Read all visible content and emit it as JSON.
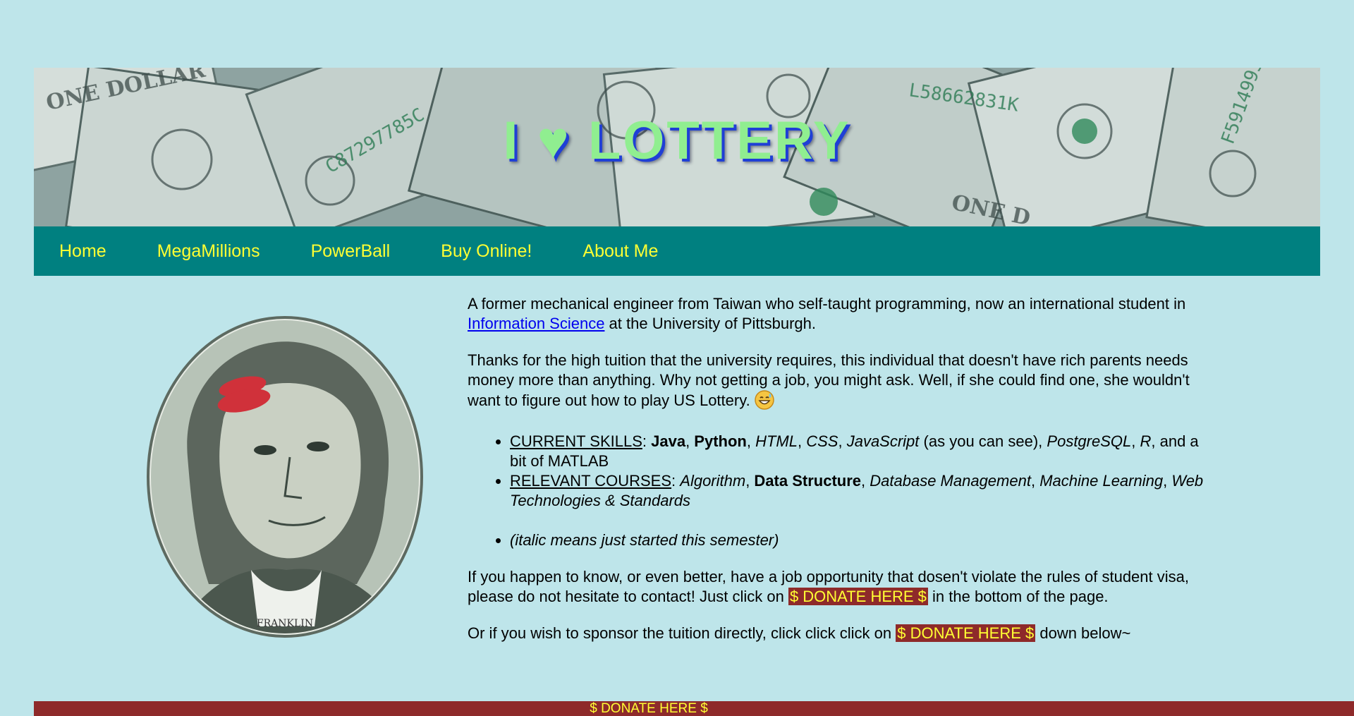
{
  "banner": {
    "title": "I ♥ LOTTERY"
  },
  "nav": {
    "items": [
      {
        "label": "Home"
      },
      {
        "label": "MegaMillions"
      },
      {
        "label": "PowerBall"
      },
      {
        "label": "Buy Online!"
      },
      {
        "label": "About Me"
      }
    ]
  },
  "about": {
    "p1_before": "A former mechanical engineer from Taiwan who self-taught programming, now an international student in ",
    "p1_link": "Information Science",
    "p1_after": " at the University of Pittsburgh.",
    "p2": "Thanks for the high tuition that the university requires, this individual that doesn't have rich parents needs money more than anything. Why not getting a job, you might ask. Well, if she could find one, she wouldn't want to figure out how to play US Lottery.",
    "skills": {
      "heading": "CURRENT SKILLS",
      "colon": ": ",
      "java": "Java",
      "python": "Python",
      "html": "HTML",
      "css": "CSS",
      "javascript": "JavaScript",
      "note": " (as you can see), ",
      "postgresql": "PostgreSQL",
      "r": "R",
      "matlab": ", and a bit of MATLAB"
    },
    "courses": {
      "heading": "RELEVANT COURSES",
      "colon": ": ",
      "algorithm": "Algorithm",
      "data_structure": "Data Structure",
      "db": "Database Management",
      "ml": "Machine Learning",
      "web": "Web Technologies & Standards"
    },
    "italic_note": "(italic means just started this semester)",
    "p3_before": "If you happen to know, or even better, have a job opportunity that dosen't violate the rules of student visa, please do not hesitate to contact! Just click on ",
    "p3_donate": "$ DONATE HERE $",
    "p3_after": " in the bottom of the page.",
    "p4_before": "Or if you wish to sponsor the tuition directly, click click click on ",
    "p4_donate": "$ DONATE HERE $",
    "p4_after": " down below~"
  },
  "footer": {
    "donate_label": "$ DONATE HERE $"
  },
  "colors": {
    "background": "#bee5ea",
    "nav": "#008080",
    "nav_text": "#ffff33",
    "donate": "#8e2a2a",
    "title": "#90ee90"
  }
}
